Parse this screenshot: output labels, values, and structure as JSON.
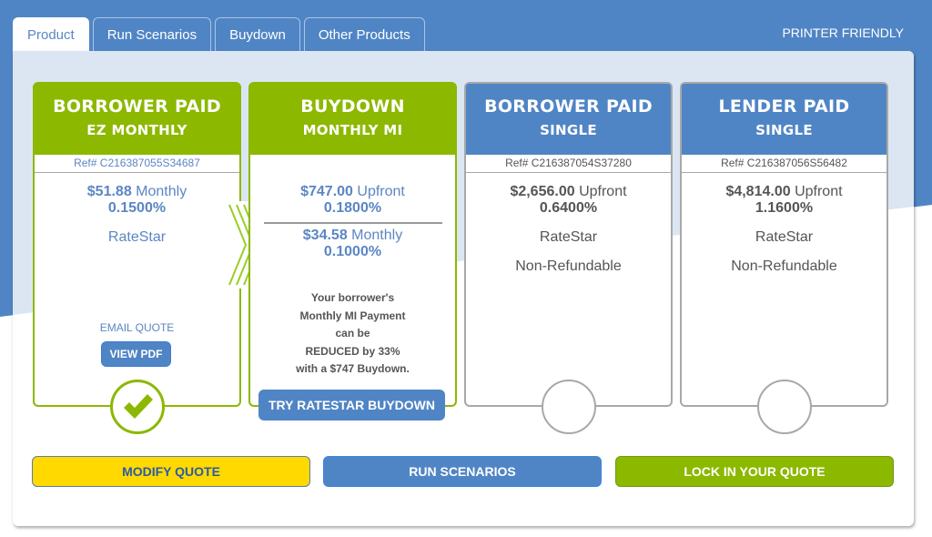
{
  "tabs": [
    {
      "label": "Product",
      "active": true
    },
    {
      "label": "Run Scenarios",
      "active": false
    },
    {
      "label": "Buydown",
      "active": false
    },
    {
      "label": "Other Products",
      "active": false
    }
  ],
  "printer_friendly": "PRINTER FRIENDLY",
  "colors": {
    "brand_blue": "#5085c5",
    "brand_green": "#8cb800",
    "modify_yellow": "#ffd900",
    "panel_tint": "#dce6f2"
  },
  "cards": [
    {
      "title_line1": "BORROWER PAID",
      "title_line2": "EZ MONTHLY",
      "ref": "Ref# C216387055S34687",
      "amount": "$51.88",
      "amount_type": "Monthly",
      "rate": "0.1500%",
      "plan": "RateStar",
      "email_quote": "EMAIL QUOTE",
      "view_pdf": "VIEW PDF",
      "selected": true
    },
    {
      "title_line1": "BUYDOWN",
      "title_line2": "MONTHLY MI",
      "upfront_amount": "$747.00",
      "upfront_type": "Upfront",
      "upfront_rate": "0.1800%",
      "monthly_amount": "$34.58",
      "monthly_type": "Monthly",
      "monthly_rate": "0.1000%",
      "promo_lines": [
        "Your borrower's",
        "Monthly MI Payment",
        "can be",
        "REDUCED by 33%",
        "with a $747 Buydown."
      ],
      "try_button": "TRY RATESTAR BUYDOWN"
    },
    {
      "title_line1": "BORROWER PAID",
      "title_line2": "SINGLE",
      "ref": "Ref# C216387054S37280",
      "amount": "$2,656.00",
      "amount_type": "Upfront",
      "rate": "0.6400%",
      "plan": "RateStar",
      "refund": "Non-Refundable",
      "selected": false
    },
    {
      "title_line1": "LENDER PAID",
      "title_line2": "SINGLE",
      "ref": "Ref# C216387056S56482",
      "amount": "$4,814.00",
      "amount_type": "Upfront",
      "rate": "1.1600%",
      "plan": "RateStar",
      "refund": "Non-Refundable",
      "selected": false
    }
  ],
  "actions": {
    "modify": "MODIFY QUOTE",
    "run": "RUN SCENARIOS",
    "lock": "LOCK IN YOUR QUOTE"
  },
  "icons": {
    "selected": "checkmark-icon",
    "arrow": "chevron-right-icon"
  }
}
